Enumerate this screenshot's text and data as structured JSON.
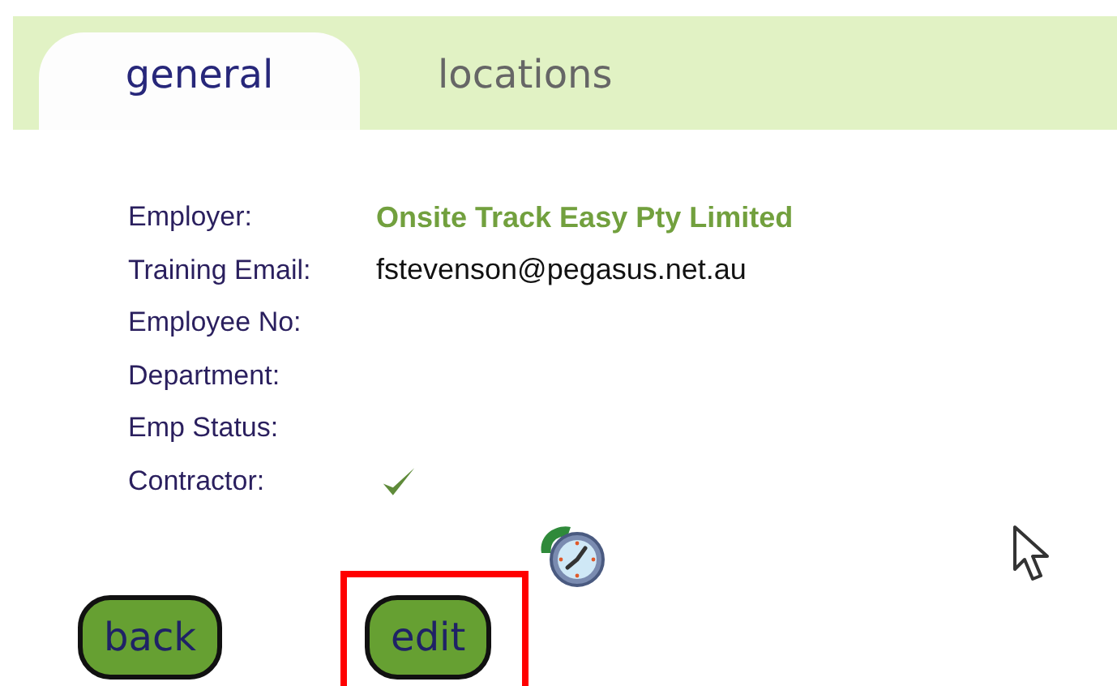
{
  "tabs": [
    {
      "label": "general",
      "selected": true
    },
    {
      "label": "locations",
      "selected": false
    }
  ],
  "details": [
    {
      "label": "Employer:",
      "value": "Onsite Track Easy Pty Limited",
      "kind": "emphasis"
    },
    {
      "label": "Training Email:",
      "value": "fstevenson@pegasus.net.au",
      "kind": "text"
    },
    {
      "label": "Employee No:",
      "kind": "text"
    },
    {
      "label": "Department:",
      "kind": "text"
    },
    {
      "label": "Emp Status:",
      "kind": "text"
    },
    {
      "label": "Contractor:",
      "kind": "check",
      "checked": true
    }
  ],
  "buttons": [
    {
      "label": "back",
      "highlighted": false
    },
    {
      "label": "edit",
      "highlighted": true
    }
  ]
}
